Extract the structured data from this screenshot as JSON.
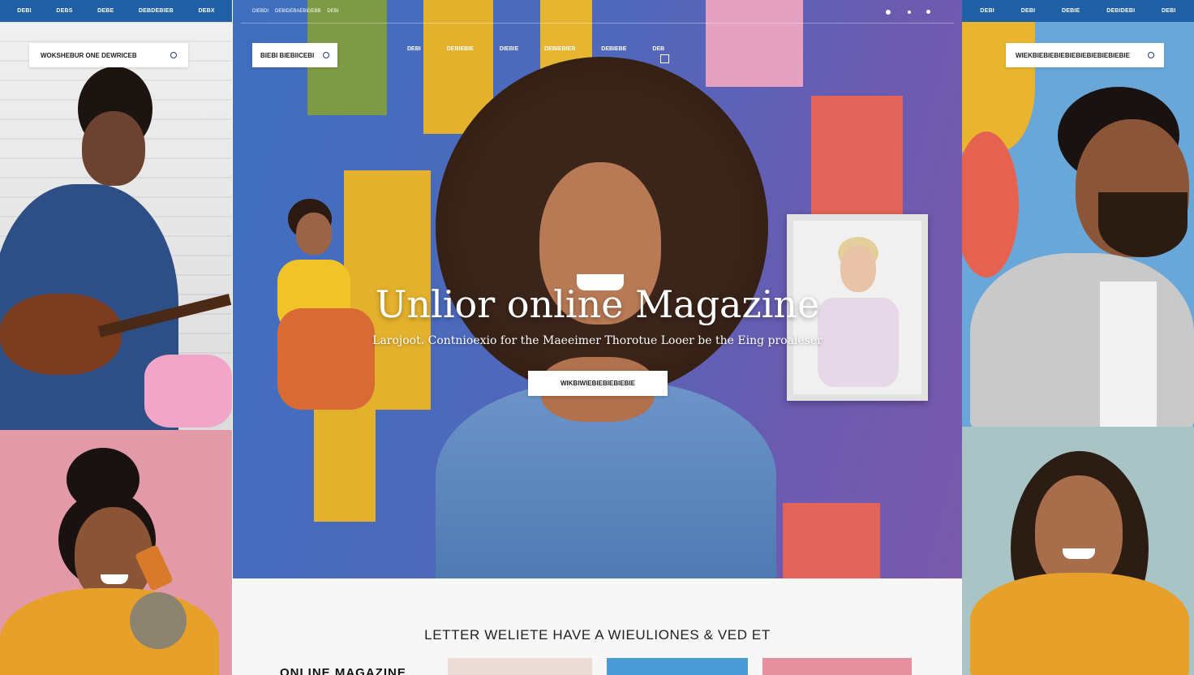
{
  "left_panel": {
    "nav_items": [
      "DEBI",
      "DEBS",
      "DEBE",
      "DEBDEBIEB",
      "DEBX"
    ],
    "search_text": "WOKSHEBUR ONE DEWRICEB",
    "colors": {
      "nav": "#1f5fa6",
      "top_bg": "#e9e9e9",
      "bottom_bg": "#e29aa9"
    }
  },
  "hero": {
    "tiny_nav": [
      "DIEBDI",
      "DEBIDEBAEBIDEBB",
      "DEBI"
    ],
    "search_text": "BIEBI BIEBIICEBI",
    "nav_items": [
      "DEBI",
      "DEBIEBIE",
      "DIEBIE",
      "DEBIEBIEB",
      "DEBIEBE",
      "DEB"
    ],
    "title": "Unlior online Magazine",
    "subtitle": "Larojoot. Contnioexio for the Maeeimer Thorotue Looer be the Eing proaleser",
    "cta_label": "WIKBIWIEBIEBIEBIEBIE",
    "colors": {
      "bg": "#5068bb",
      "yellow": "#e7b630",
      "green": "#7f9a45",
      "coral": "#e2645a",
      "pink": "#e6a0c0"
    }
  },
  "bottom": {
    "heading": "LETTER WELIETE HAVE A WIEULIONES & VED ET",
    "section_label": "ONLINE MAGAZINE"
  },
  "right_panel": {
    "nav_items": [
      "DEBI",
      "DEBI",
      "DEBIE",
      "DEBIDEBI",
      "DEBI"
    ],
    "search_text": "WIEKBIEBIEBIEBIEBIEBIEBIEBIEBIE",
    "colors": {
      "top_bg": "#6aa7d9",
      "bottom_bg": "#a9c4c4"
    }
  }
}
